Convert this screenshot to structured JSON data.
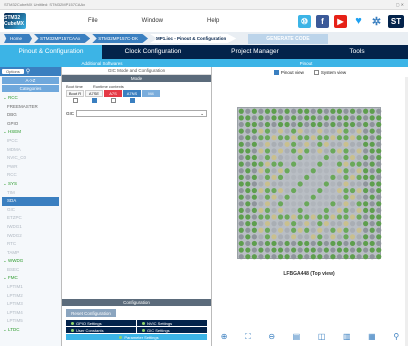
{
  "window": {
    "title": "STM32CubeMX Untitled: STM32MP157CAAx"
  },
  "menu": {
    "logo": "STM32 CubeMX",
    "items": [
      "File",
      "Window",
      "Help"
    ]
  },
  "crumbs": [
    "Home",
    "STM32MP157CAAx",
    "STM32MP157C-DK",
    "MP1.ioc - Pinout & Configuration"
  ],
  "generate_label": "GENERATE CODE",
  "tabs": [
    "Pinout & Configuration",
    "Clock Configuration",
    "Project Manager",
    "Tools"
  ],
  "subtabs": [
    "Additional Softwares",
    "Pinout"
  ],
  "left": {
    "search_label": "Options",
    "sort_label": "A->Z",
    "categories_label": "Categories",
    "items": [
      {
        "label": "RCC",
        "type": "grp"
      },
      {
        "label": "FREEMASTER",
        "type": "item"
      },
      {
        "label": "DBG",
        "type": "item"
      },
      {
        "label": "GPIO",
        "type": "item"
      },
      {
        "label": "HSEM",
        "type": "grp"
      },
      {
        "label": "IPCC",
        "type": "dim"
      },
      {
        "label": "MDMA",
        "type": "dim"
      },
      {
        "label": "NVIC_C0",
        "type": "dim"
      },
      {
        "label": "PWR",
        "type": "dim"
      },
      {
        "label": "RCC",
        "type": "dim"
      },
      {
        "label": "SYS",
        "type": "grp"
      },
      {
        "label": "TIM",
        "type": "dim"
      },
      {
        "label": "SDA",
        "type": "sel"
      },
      {
        "label": "GIC",
        "type": "dim"
      },
      {
        "label": "ETZPC",
        "type": "dim"
      },
      {
        "label": "IWDG1",
        "type": "dim"
      },
      {
        "label": "IWDG2",
        "type": "dim"
      },
      {
        "label": "RTC",
        "type": "dim"
      },
      {
        "label": "TAMP",
        "type": "dim"
      },
      {
        "label": "WWDG",
        "type": "grp"
      },
      {
        "label": "BSEC",
        "type": "dim"
      },
      {
        "label": "FMC",
        "type": "grp"
      },
      {
        "label": "LPTIM1",
        "type": "dim"
      },
      {
        "label": "LPTIM2",
        "type": "dim"
      },
      {
        "label": "LPTIM3",
        "type": "dim"
      },
      {
        "label": "LPTIM4",
        "type": "dim"
      },
      {
        "label": "LPTIM5",
        "type": "dim"
      },
      {
        "label": "LTDC",
        "type": "grp"
      }
    ]
  },
  "center": {
    "header": "GIC Mode and Configuration",
    "mode_label": "Mode",
    "runtime_label": "Boot time",
    "runtime_ctx_label": "Runtime contexts",
    "boot_cells": [
      "Boot R",
      "A7SE"
    ],
    "runtime_cells": [
      "A7S",
      "A7NS",
      "M4"
    ],
    "check_on": [
      false,
      true,
      false,
      true
    ],
    "select_prefix": "GIC",
    "select_value": "",
    "config_label": "Configuration",
    "reset_label": "Reset Configuration",
    "settings": [
      "GPIO Settings",
      "NVIC Settings",
      "User Constants",
      "GIC Settings",
      "Parameter Settings"
    ]
  },
  "right": {
    "view_pinout": "Pinout view",
    "view_system": "System view",
    "package": "LFBGA448 (Top view)"
  }
}
